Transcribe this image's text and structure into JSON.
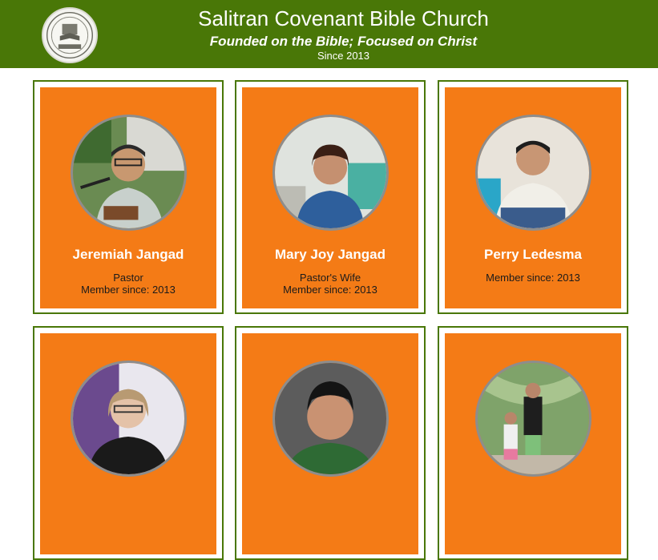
{
  "header": {
    "title": "Salitran Covenant Bible Church",
    "tagline": "Founded on the Bible;  Focused on Christ",
    "since": "Since 2013",
    "colors": {
      "header_bg": "#497707",
      "card_bg": "#f47b16",
      "card_border": "#497707"
    }
  },
  "members": [
    {
      "name": "Jeremiah Jangad",
      "role": "Pastor",
      "since": "Member since: 2013"
    },
    {
      "name": "Mary Joy Jangad",
      "role": "Pastor's Wife",
      "since": "Member since: 2013"
    },
    {
      "name": "Perry Ledesma",
      "role": "",
      "since": "Member since: 2013"
    },
    {
      "name": "",
      "role": "",
      "since": ""
    },
    {
      "name": "",
      "role": "",
      "since": ""
    },
    {
      "name": "",
      "role": "",
      "since": ""
    }
  ]
}
